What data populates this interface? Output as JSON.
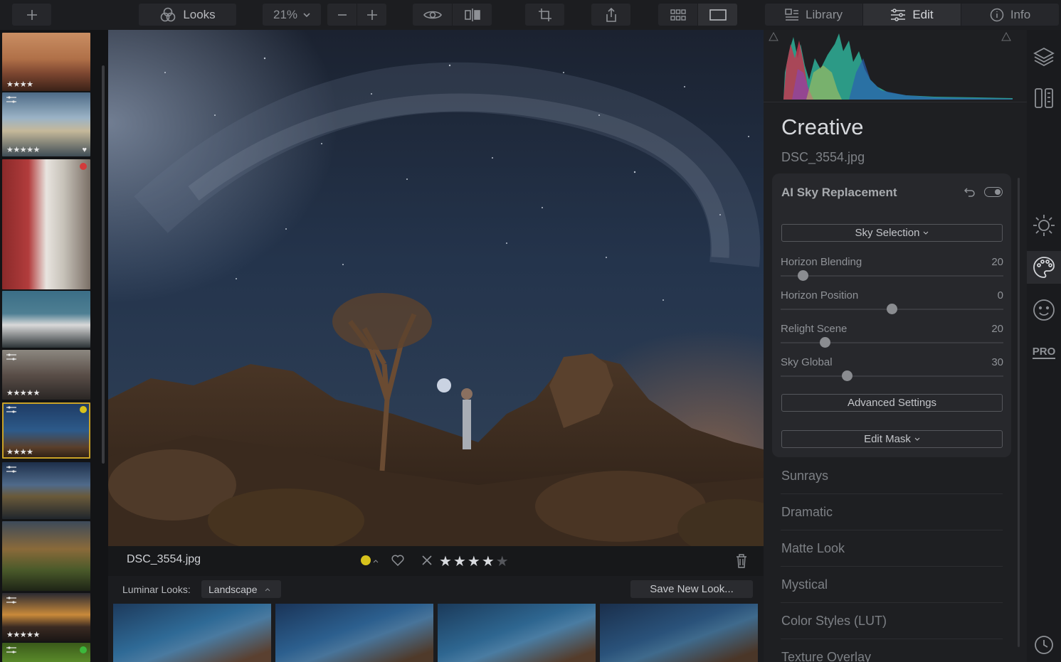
{
  "toolbar": {
    "add_label": "+",
    "looks_label": "Looks",
    "zoom": "21%",
    "zoom_out": "−",
    "zoom_in": "+",
    "library_label": "Library",
    "edit_label": "Edit",
    "info_label": "Info"
  },
  "filmstrip": {
    "thumbs": [
      {
        "stars": "★★★★",
        "adjusted": false,
        "liked": false,
        "color_label": null,
        "selected": false
      },
      {
        "stars": "★★★★★",
        "adjusted": true,
        "liked": true,
        "color_label": null,
        "selected": false
      },
      {
        "stars": "",
        "adjusted": false,
        "liked": false,
        "color_label": "#d23b3b",
        "selected": false
      },
      {
        "stars": "",
        "adjusted": false,
        "liked": false,
        "color_label": null,
        "selected": false
      },
      {
        "stars": "★★★★★",
        "adjusted": true,
        "liked": false,
        "color_label": null,
        "selected": false
      },
      {
        "stars": "★★★★",
        "adjusted": true,
        "liked": false,
        "color_label": "#d7c21c",
        "selected": true
      },
      {
        "stars": "",
        "adjusted": true,
        "liked": false,
        "color_label": null,
        "selected": false
      },
      {
        "stars": "",
        "adjusted": false,
        "liked": false,
        "color_label": null,
        "selected": false
      },
      {
        "stars": "★★★★★",
        "adjusted": true,
        "liked": false,
        "color_label": null,
        "selected": false
      },
      {
        "stars": "",
        "adjusted": true,
        "liked": false,
        "color_label": "#3cb83c",
        "selected": false
      }
    ]
  },
  "infobar": {
    "filename": "DSC_3554.jpg",
    "color_label": "#d7c21c",
    "rating": 4,
    "max_rating": 5,
    "star_char": "★"
  },
  "looks": {
    "label": "Luminar Looks:",
    "category": "Landscape",
    "save_label": "Save New Look..."
  },
  "panel": {
    "section_title": "Creative",
    "filename": "DSC_3554.jpg",
    "tool_title": "AI Sky Replacement",
    "sky_selection": "Sky Selection",
    "sliders": [
      {
        "name": "Horizon Blending",
        "value": "20",
        "pos": 0.1
      },
      {
        "name": "Horizon Position",
        "value": "0",
        "pos": 0.5
      },
      {
        "name": "Relight Scene",
        "value": "20",
        "pos": 0.2
      },
      {
        "name": "Sky Global",
        "value": "30",
        "pos": 0.3
      }
    ],
    "advanced_label": "Advanced Settings",
    "edit_mask_label": "Edit Mask",
    "tools": [
      "Sunrays",
      "Dramatic",
      "Matte Look",
      "Mystical",
      "Color Styles (LUT)",
      "Texture Overlay"
    ]
  },
  "side_strip": {
    "icons": [
      "layers-icon",
      "canvas-icon",
      "essentials-sun-icon",
      "creative-palette-icon",
      "portrait-face-icon",
      "pro-badge-icon",
      "history-clock-icon"
    ],
    "pro_label": "PRO"
  },
  "colors": {
    "accent_selected": "#c9a227",
    "panel_bg": "#1e1f22",
    "toolbar_bg": "#1c1d20"
  }
}
